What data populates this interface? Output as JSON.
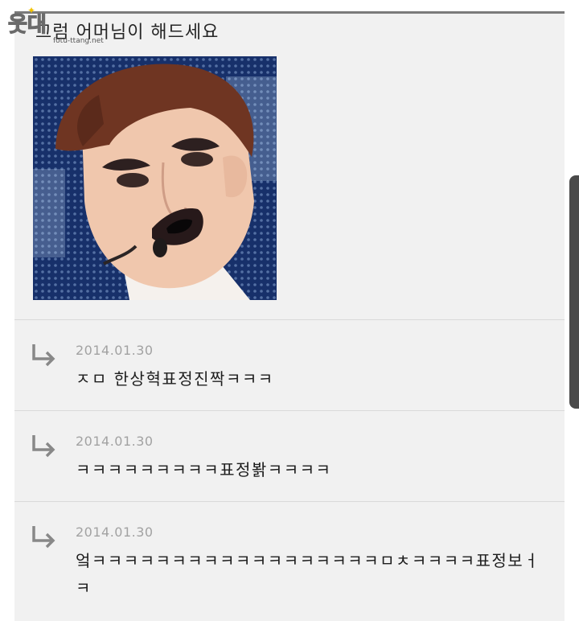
{
  "post": {
    "title": "그럼 어머님이 해드세요",
    "image_alt": "photo of a man with dark lipstick and a headset microphone"
  },
  "comments": [
    {
      "date": "2014.01.30",
      "text": "ㅈㅁ 한상혁표정진짝ㅋㅋㅋ"
    },
    {
      "date": "2014.01.30",
      "text": "ㅋㅋㅋㅋㅋㅋㅋㅋㅋ표정봙ㅋㅋㅋㅋ"
    },
    {
      "date": "2014.01.30",
      "text": "엌ㅋㅋㅋㅋㅋㅋㅋㅋㅋㅋㅋㅋㅋㅋㅋㅋㅋㅋㅁㅊㅋㅋㅋㅋ표정보ㅓㅋ"
    }
  ],
  "watermark": {
    "logo_text": "웃대",
    "url": "fotu-ttang.net"
  },
  "icons": {
    "reply": "reply-arrow-icon",
    "watermark": "logo-icon"
  },
  "colors": {
    "panel_background": "#f1f1f1",
    "top_rule": "#7a7a7a",
    "date_text": "#a2a2a2",
    "comment_text": "#1d1d1d",
    "reply_arrow": "#888888"
  }
}
